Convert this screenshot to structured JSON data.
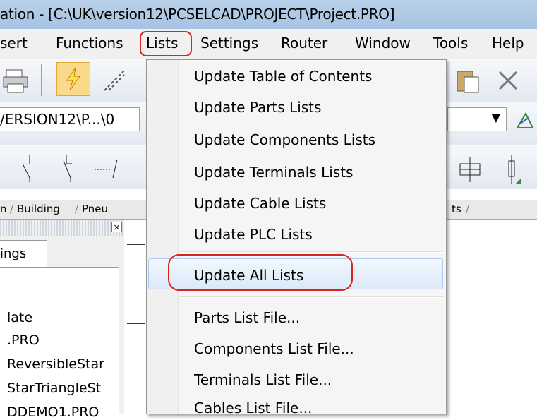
{
  "window": {
    "title": "ation - [C:\\UK\\version12\\PCSELCAD\\PROJECT\\Project.PRO]"
  },
  "menubar": {
    "items": [
      {
        "label": "sert"
      },
      {
        "label": "Functions"
      },
      {
        "label": "Lists"
      },
      {
        "label": "Settings"
      },
      {
        "label": "Router"
      },
      {
        "label": "Window"
      },
      {
        "label": "Tools"
      },
      {
        "label": "Help"
      }
    ]
  },
  "toolbar": {
    "path_combo": "/ERSION12\\P...\\0",
    "icons": [
      "print-icon",
      "lightning-icon",
      "wire-icon",
      "clipboard-icon",
      "cut-icon",
      "undo-icon"
    ]
  },
  "tabs": {
    "items": [
      {
        "label": "n"
      },
      {
        "label": "Building"
      },
      {
        "label": "Pneu"
      },
      {
        "label": "ts"
      }
    ]
  },
  "left_panel": {
    "tab_label": "ings",
    "items": [
      {
        "label": "late"
      },
      {
        "label": ".PRO"
      },
      {
        "label": "ReversibleStar"
      },
      {
        "label": "StarTriangleSt"
      },
      {
        "label": "DDEMO1.PRO"
      }
    ]
  },
  "dropdown": {
    "items": [
      {
        "label": "Update Table of Contents"
      },
      {
        "label": "Update Parts Lists"
      },
      {
        "label": "Update Components Lists"
      },
      {
        "label": "Update Terminals Lists"
      },
      {
        "label": "Update Cable Lists"
      },
      {
        "label": "Update PLC Lists"
      },
      {
        "label": "Update All Lists"
      },
      {
        "label": "Parts List File..."
      },
      {
        "label": "Components List File..."
      },
      {
        "label": "Terminals List File..."
      },
      {
        "label": "Cables List File..."
      }
    ]
  },
  "colors": {
    "highlight_outline": "#d9261c",
    "menu_highlight": "#dbe9f8"
  }
}
